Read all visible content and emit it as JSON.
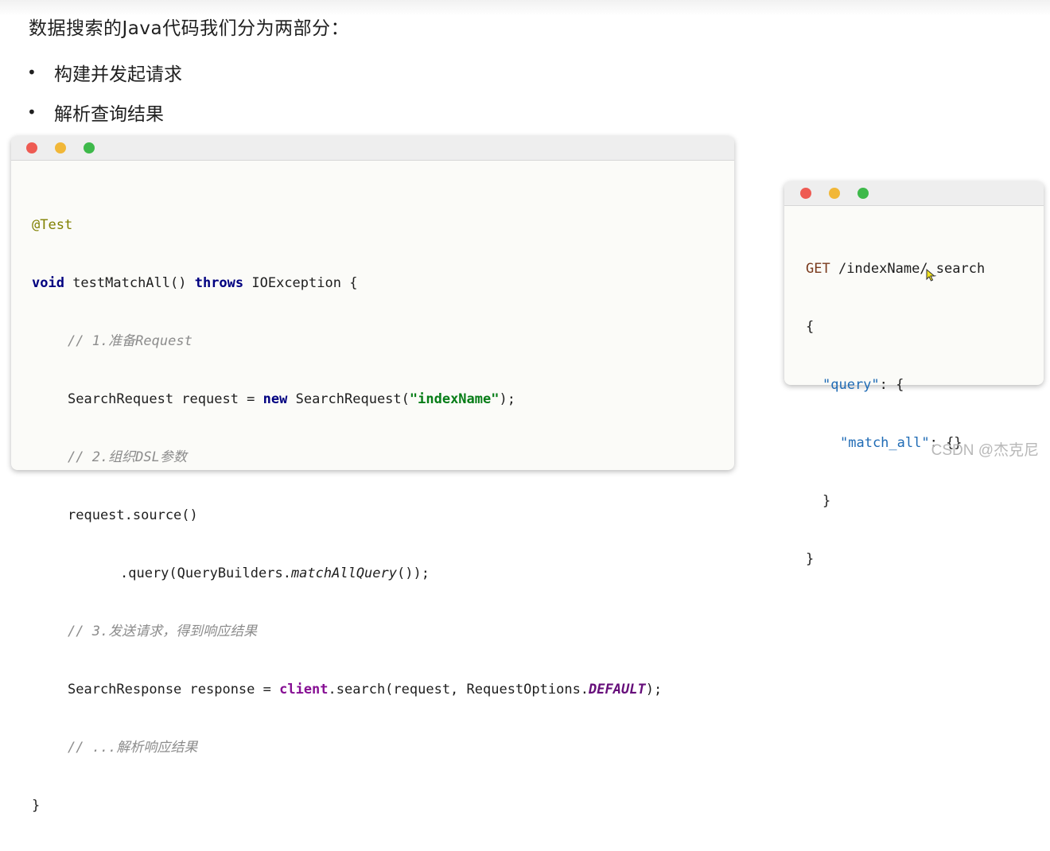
{
  "heading": "数据搜索的Java代码我们分为两部分：",
  "bullets": [
    "构建并发起请求",
    "解析查询结果"
  ],
  "bullet_symbol": "•",
  "java_code": {
    "annotation": "@Test",
    "kw_void": "void",
    "method_sig": " testMatchAll() ",
    "kw_throws": "throws",
    "exception_part": " IOException {",
    "comment1": "// 1.准备Request",
    "l4_a": "SearchRequest request = ",
    "kw_new": "new",
    "l4_b": " SearchRequest(",
    "l4_str": "\"indexName\"",
    "l4_c": ");",
    "comment2": "// 2.组织DSL参数",
    "l6": "request.source()",
    "l7_a": ".query(QueryBuilders.",
    "l7_method": "matchAllQuery",
    "l7_b": "());",
    "comment3": "// 3.发送请求，得到响应结果",
    "l9_a": "SearchResponse response = ",
    "l9_client": "client",
    "l9_b": ".search(request, RequestOptions.",
    "l9_const": "DEFAULT",
    "l9_c": ");",
    "comment4": "// ...解析响应结果",
    "closing": "}"
  },
  "dsl_code": {
    "method": "GET",
    "path": " /indexName/_search",
    "open": "{",
    "query_key": "\"query\"",
    "query_rest": ": {",
    "match_key": "\"match_all\"",
    "match_rest": ": {}",
    "inner_close": "}",
    "outer_close": "}"
  },
  "watermark": "CSDN @杰克尼",
  "colors": {
    "traffic_red": "#ee5b53",
    "traffic_yellow": "#f1b738",
    "traffic_green": "#3eb94a",
    "keyword": "#000080",
    "string": "#067d17",
    "comment": "#8c8c8c"
  }
}
